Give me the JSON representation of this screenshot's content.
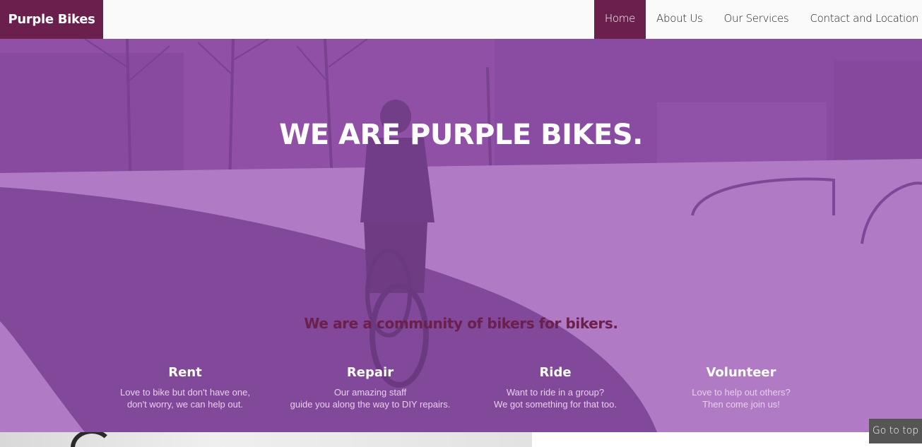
{
  "brand": {
    "name": "Purple Bikes"
  },
  "nav": {
    "items": [
      {
        "label": "Home",
        "active": true
      },
      {
        "label": "About Us",
        "active": false
      },
      {
        "label": "Our Services",
        "active": false
      },
      {
        "label": "Contact and Location",
        "active": false
      }
    ]
  },
  "hero": {
    "title": "WE ARE PURPLE BIKES.",
    "subtitle": "We are a community of bikers for bikers.",
    "features": [
      {
        "title": "Rent",
        "line1": "Love to bike but don't have one,",
        "line2": "don't worry, we can help out."
      },
      {
        "title": "Repair",
        "line1": "Our amazing staff",
        "line2": "guide you along the way to DIY repairs."
      },
      {
        "title": "Ride",
        "line1": "Want to ride in a group?",
        "line2": "We got something for that too."
      },
      {
        "title": "Volunteer",
        "line1": "Love to help out others?",
        "line2": "Then come join us!"
      }
    ]
  },
  "go_to_top": {
    "label": "Go to top"
  },
  "colors": {
    "brand": "#6b1f4c",
    "overlay": "#a054be",
    "navbar": "#fafafa"
  }
}
